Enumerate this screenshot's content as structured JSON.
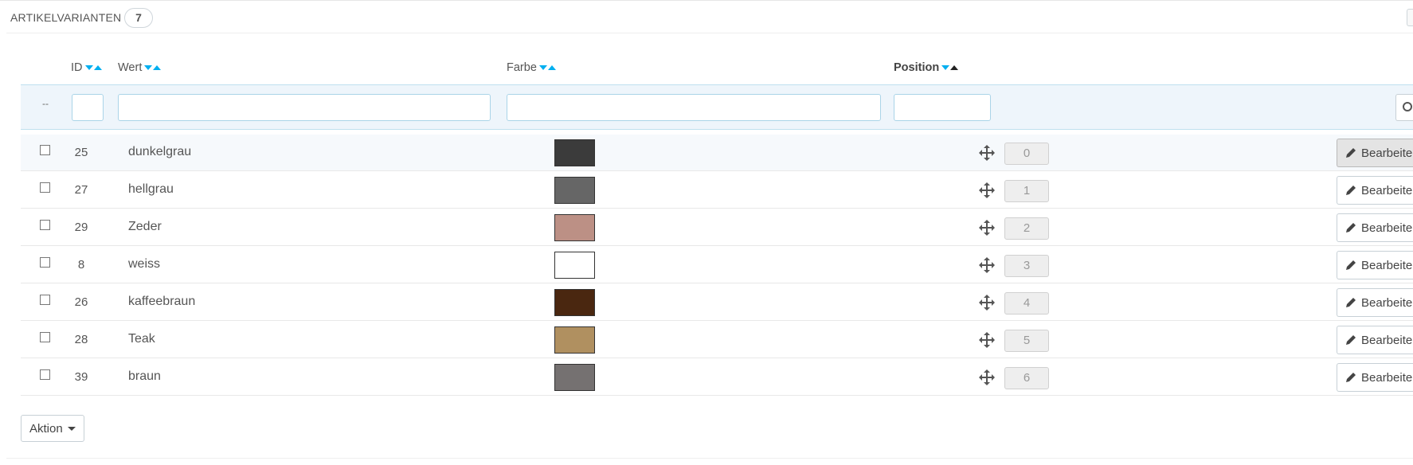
{
  "panel": {
    "title": "ARTIKELVARIANTEN",
    "count": "7"
  },
  "columns": {
    "id": "ID",
    "wert": "Wert",
    "farbe": "Farbe",
    "position": "Position"
  },
  "filter": {
    "dash": "--",
    "id_value": "",
    "wert_value": "",
    "farbe_value": "",
    "position_value": ""
  },
  "rows": [
    {
      "id": "25",
      "wert": "dunkelgrau",
      "color": "#3b3b3b",
      "position": "0",
      "edit": "Bearbeiten"
    },
    {
      "id": "27",
      "wert": "hellgrau",
      "color": "#666666",
      "position": "1",
      "edit": "Bearbeiten"
    },
    {
      "id": "29",
      "wert": "Zeder",
      "color": "#bc9085",
      "position": "2",
      "edit": "Bearbeiten"
    },
    {
      "id": "8",
      "wert": "weiss",
      "color": "#ffffff",
      "position": "3",
      "edit": "Bearbeiten"
    },
    {
      "id": "26",
      "wert": "kaffeebraun",
      "color": "#4a2710",
      "position": "4",
      "edit": "Bearbeiten"
    },
    {
      "id": "28",
      "wert": "Teak",
      "color": "#b09060",
      "position": "5",
      "edit": "Bearbeiten"
    },
    {
      "id": "39",
      "wert": "braun",
      "color": "#757171",
      "position": "6",
      "edit": "Bearbeiten"
    }
  ],
  "bulk_action": {
    "label": "Aktion"
  },
  "colors": {
    "accent": "#00aff0",
    "filter_bg": "#eef5fb"
  },
  "icons": {
    "sort_down": "sort-desc-icon",
    "sort_up": "sort-asc-icon",
    "move": "move-arrows-icon",
    "edit": "pencil-icon",
    "search": "search-icon"
  }
}
